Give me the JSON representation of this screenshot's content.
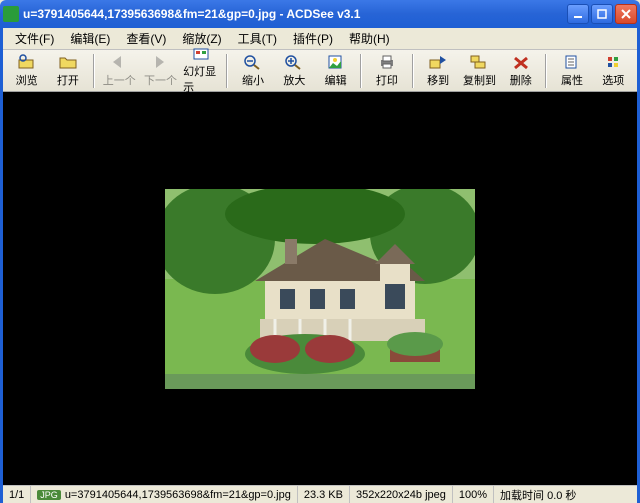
{
  "titlebar": {
    "title": "u=3791405644,1739563698&fm=21&gp=0.jpg - ACDSee v3.1"
  },
  "menu": {
    "file": "文件(F)",
    "edit": "编辑(E)",
    "view": "查看(V)",
    "zoom": "缩放(Z)",
    "tools": "工具(T)",
    "plugins": "插件(P)",
    "help": "帮助(H)"
  },
  "toolbar": {
    "browse": "浏览",
    "open": "打开",
    "prev": "上一个",
    "next": "下一个",
    "slideshow": "幻灯显示",
    "zoomout": "缩小",
    "zoomin": "放大",
    "editor": "编辑",
    "print": "打印",
    "moveto": "移到",
    "copyto": "复制到",
    "delete": "删除",
    "properties": "属性",
    "options": "选项"
  },
  "status": {
    "position": "1/1",
    "badge": "JPG",
    "filename": "u=3791405644,1739563698&fm=21&gp=0.jpg",
    "filesize": "23.3 KB",
    "dimensions": "352x220x24b jpeg",
    "zoom": "100%",
    "loadtime": "加载时间 0.0 秒"
  }
}
